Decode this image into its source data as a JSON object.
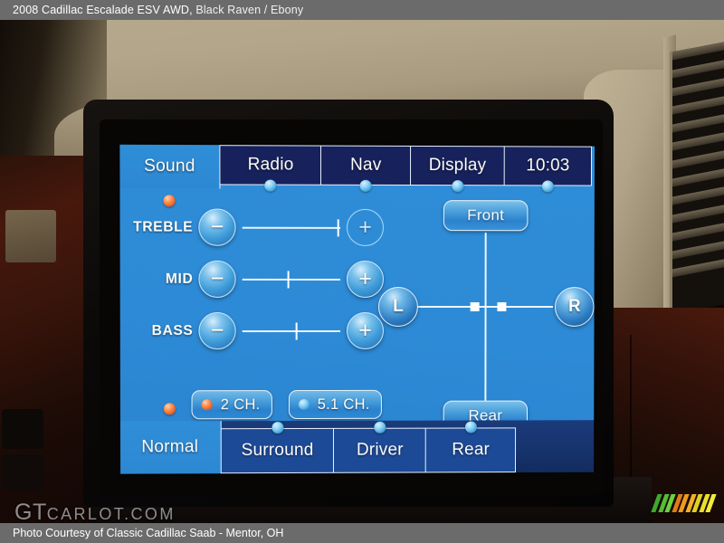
{
  "top_caption": {
    "vehicle": "2008 Cadillac Escalade ESV AWD,",
    "colors": "Black Raven / Ebony"
  },
  "bottom_caption": {
    "text": "Photo Courtesy of Classic Cadillac Saab - Mentor, OH"
  },
  "watermark": {
    "prefix": "GT",
    "suffix": "CARLOT.COM"
  },
  "colorbars": {
    "colors": [
      "#3fa82e",
      "#55bd33",
      "#6fd13a",
      "#e07b18",
      "#ef9a1c",
      "#f3b024",
      "#dfd222",
      "#e9e02c",
      "#f2ec3a"
    ]
  },
  "screen": {
    "background_color": "#2d8ad6",
    "accent_selected": "#ff7a35",
    "accent_unselected": "#7cc8ef",
    "top_tabs": [
      {
        "label": "Sound",
        "active": true,
        "dot": "selected"
      },
      {
        "label": "Radio",
        "active": false,
        "dot": "unselected"
      },
      {
        "label": "Nav",
        "active": false,
        "dot": "unselected"
      },
      {
        "label": "Display",
        "active": false,
        "dot": "unselected"
      },
      {
        "label": "10:03",
        "active": false,
        "dot": "unselected"
      }
    ],
    "equalizer": {
      "rows": [
        {
          "label": "TREBLE",
          "minus": "−",
          "plus": "+",
          "position_pct": 96,
          "plus_pressed": true
        },
        {
          "label": "MID",
          "minus": "−",
          "plus": "+",
          "position_pct": 47,
          "plus_pressed": false
        },
        {
          "label": "BASS",
          "minus": "−",
          "plus": "+",
          "position_pct": 55,
          "plus_pressed": false
        }
      ]
    },
    "channel_buttons": [
      {
        "label": "2 CH.",
        "selected": true
      },
      {
        "label": "5.1 CH.",
        "selected": false
      }
    ],
    "fader": {
      "front_label": "Front",
      "rear_label": "Rear",
      "left_label": "L",
      "right_label": "R",
      "balance_pct": 50,
      "fade_pct": 50
    },
    "bottom_tabs": [
      {
        "label": "Normal",
        "active": true,
        "dot": "selected"
      },
      {
        "label": "Surround",
        "active": false,
        "dot": "unselected"
      },
      {
        "label": "Driver",
        "active": false,
        "dot": "unselected"
      },
      {
        "label": "Rear",
        "active": false,
        "dot": "unselected"
      }
    ]
  }
}
